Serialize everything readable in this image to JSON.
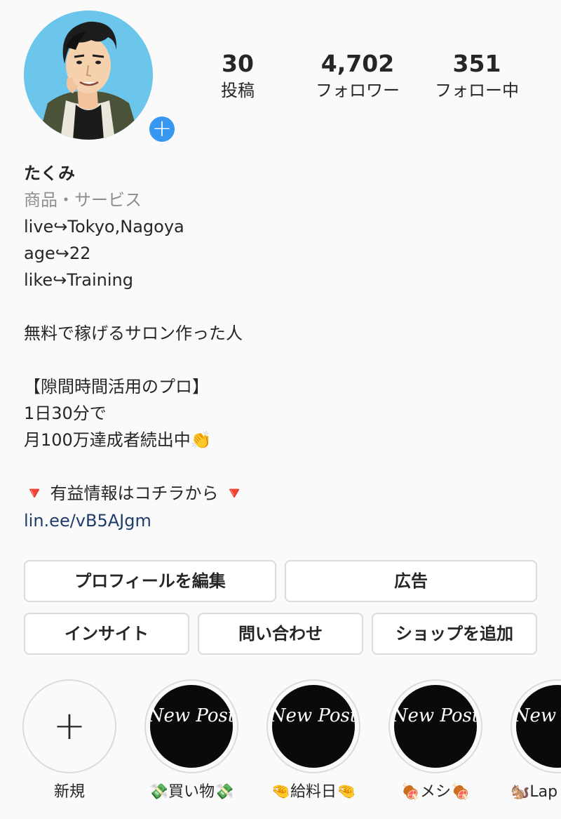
{
  "stats": {
    "posts": {
      "count": "30",
      "label": "投稿"
    },
    "followers": {
      "count": "4,702",
      "label": "フォロワー"
    },
    "following": {
      "count": "351",
      "label": "フォロー中"
    }
  },
  "profile": {
    "name": "たくみ",
    "category": "商品・サービス",
    "bio_lines": [
      "live↪Tokyo,Nagoya",
      "age↪22",
      "like↪Training",
      "",
      "無料で稼げるサロン作った人",
      "",
      "【隙間時間活用のプロ】",
      "1日30分で",
      "月100万達成者続出中👏",
      "",
      "🔻 有益情報はコチラから 🔻"
    ],
    "link": "lin.ee/vB5AJgm"
  },
  "buttons": {
    "edit_profile": "プロフィールを編集",
    "ads": "広告",
    "insights": "インサイト",
    "contact": "問い合わせ",
    "add_shop": "ショップを追加"
  },
  "highlights": {
    "new": {
      "label": "新規"
    },
    "items": [
      {
        "label": "💸買い物💸",
        "cover_text": "New Post"
      },
      {
        "label": "🤏給料日🤏",
        "cover_text": "New Post"
      },
      {
        "label": "🍖メシ🍖",
        "cover_text": "New Post"
      },
      {
        "label": "🐿️Lap",
        "cover_text": "New Post"
      }
    ]
  },
  "icons": [
    "add-story-icon",
    "plus-icon"
  ],
  "colors": {
    "accent": "#3897f0",
    "link": "#1f3c6b",
    "muted": "#8e8e8e",
    "border": "#dbdbdb"
  }
}
